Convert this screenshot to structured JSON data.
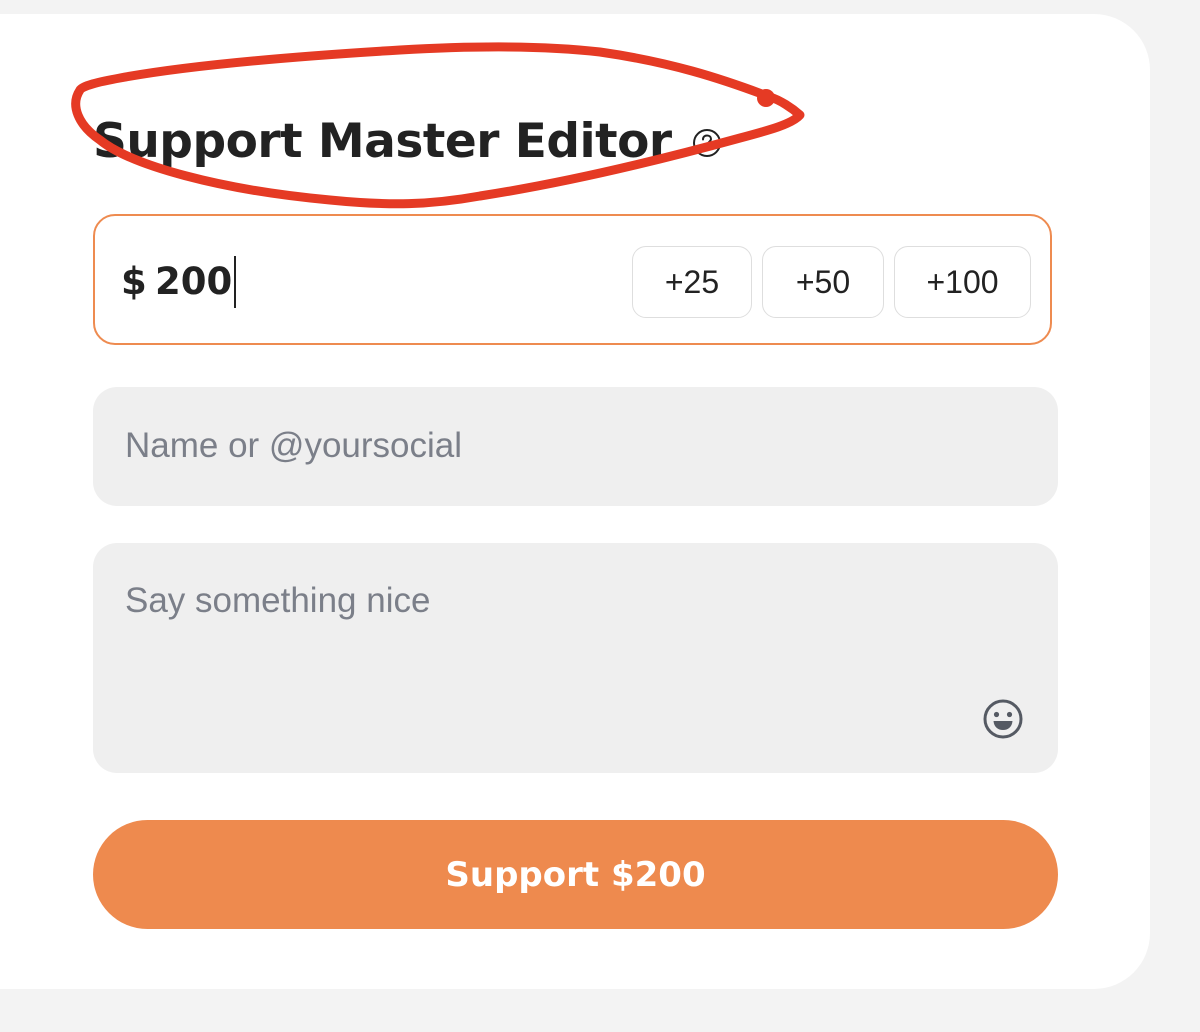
{
  "support_form": {
    "title": "Support Master Editor",
    "help_icon": "question-circle-icon",
    "amount": {
      "currency_symbol": "$",
      "value": "200",
      "presets": [
        "+25",
        "+50",
        "+100"
      ]
    },
    "name_field": {
      "placeholder": "Name or @yoursocial",
      "value": ""
    },
    "message_field": {
      "placeholder": "Say something nice",
      "value": "",
      "emoji_icon": "smiley-face-icon"
    },
    "submit_button": {
      "label": "Support $200"
    }
  },
  "annotation": {
    "type": "hand-drawn circle around title",
    "color": "#e53a24"
  },
  "colors": {
    "accent": "#ee8a4e",
    "accent_border": "#ee8b50",
    "field_background": "#efefef",
    "page_background": "#f3f3f3",
    "card_background": "#ffffff",
    "text": "#222222",
    "placeholder": "#7b7f89"
  }
}
